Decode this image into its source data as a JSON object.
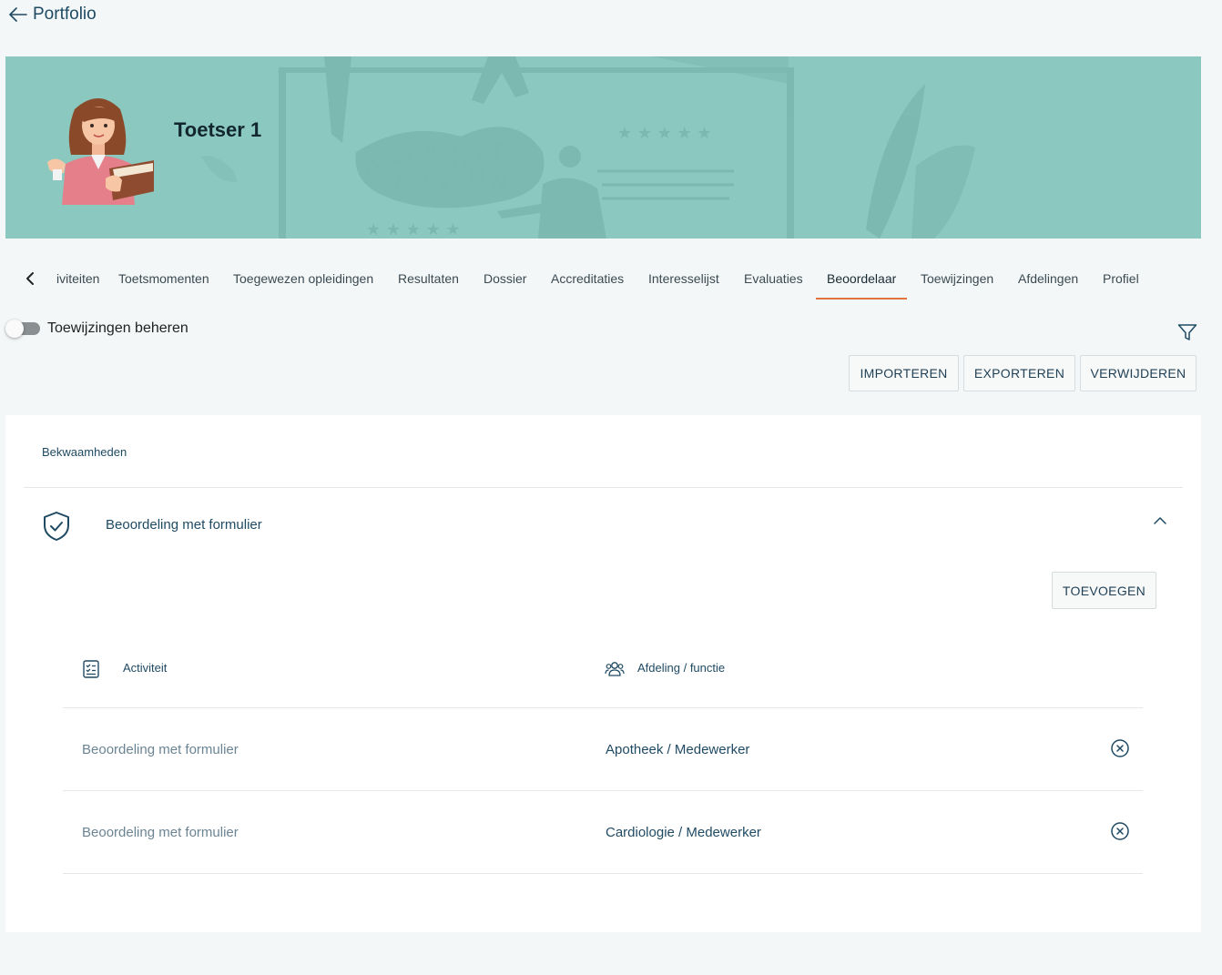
{
  "header": {
    "back_label": "Portfolio"
  },
  "banner": {
    "name": "Toetser 1"
  },
  "tabs": [
    {
      "label": "iviteiten"
    },
    {
      "label": "Toetsmomenten"
    },
    {
      "label": "Toegewezen opleidingen"
    },
    {
      "label": "Resultaten"
    },
    {
      "label": "Dossier"
    },
    {
      "label": "Accreditaties"
    },
    {
      "label": "Interesselijst"
    },
    {
      "label": "Evaluaties"
    },
    {
      "label": "Beoordelaar",
      "active": true
    },
    {
      "label": "Toewijzingen"
    },
    {
      "label": "Afdelingen"
    },
    {
      "label": "Profiel"
    }
  ],
  "toolbar": {
    "toggle_label": "Toewijzingen beheren",
    "toggle_on": false,
    "import_label": "IMPORTEREN",
    "export_label": "EXPORTEREN",
    "delete_label": "VERWIJDEREN"
  },
  "card": {
    "section_label": "Bekwaamheden",
    "group": {
      "title": "Beoordeling met formulier",
      "expanded": true,
      "add_label": "TOEVOEGEN",
      "columns": {
        "activity": "Activiteit",
        "department": "Afdeling / functie"
      },
      "rows": [
        {
          "activity": "Beoordeling met formulier",
          "department": "Apotheek / Medewerker"
        },
        {
          "activity": "Beoordeling met formulier",
          "department": "Cardiologie / Medewerker"
        }
      ]
    }
  },
  "colors": {
    "banner": "#8bc8bf",
    "accent": "#e0743c",
    "primary_text": "#1f4a63"
  }
}
